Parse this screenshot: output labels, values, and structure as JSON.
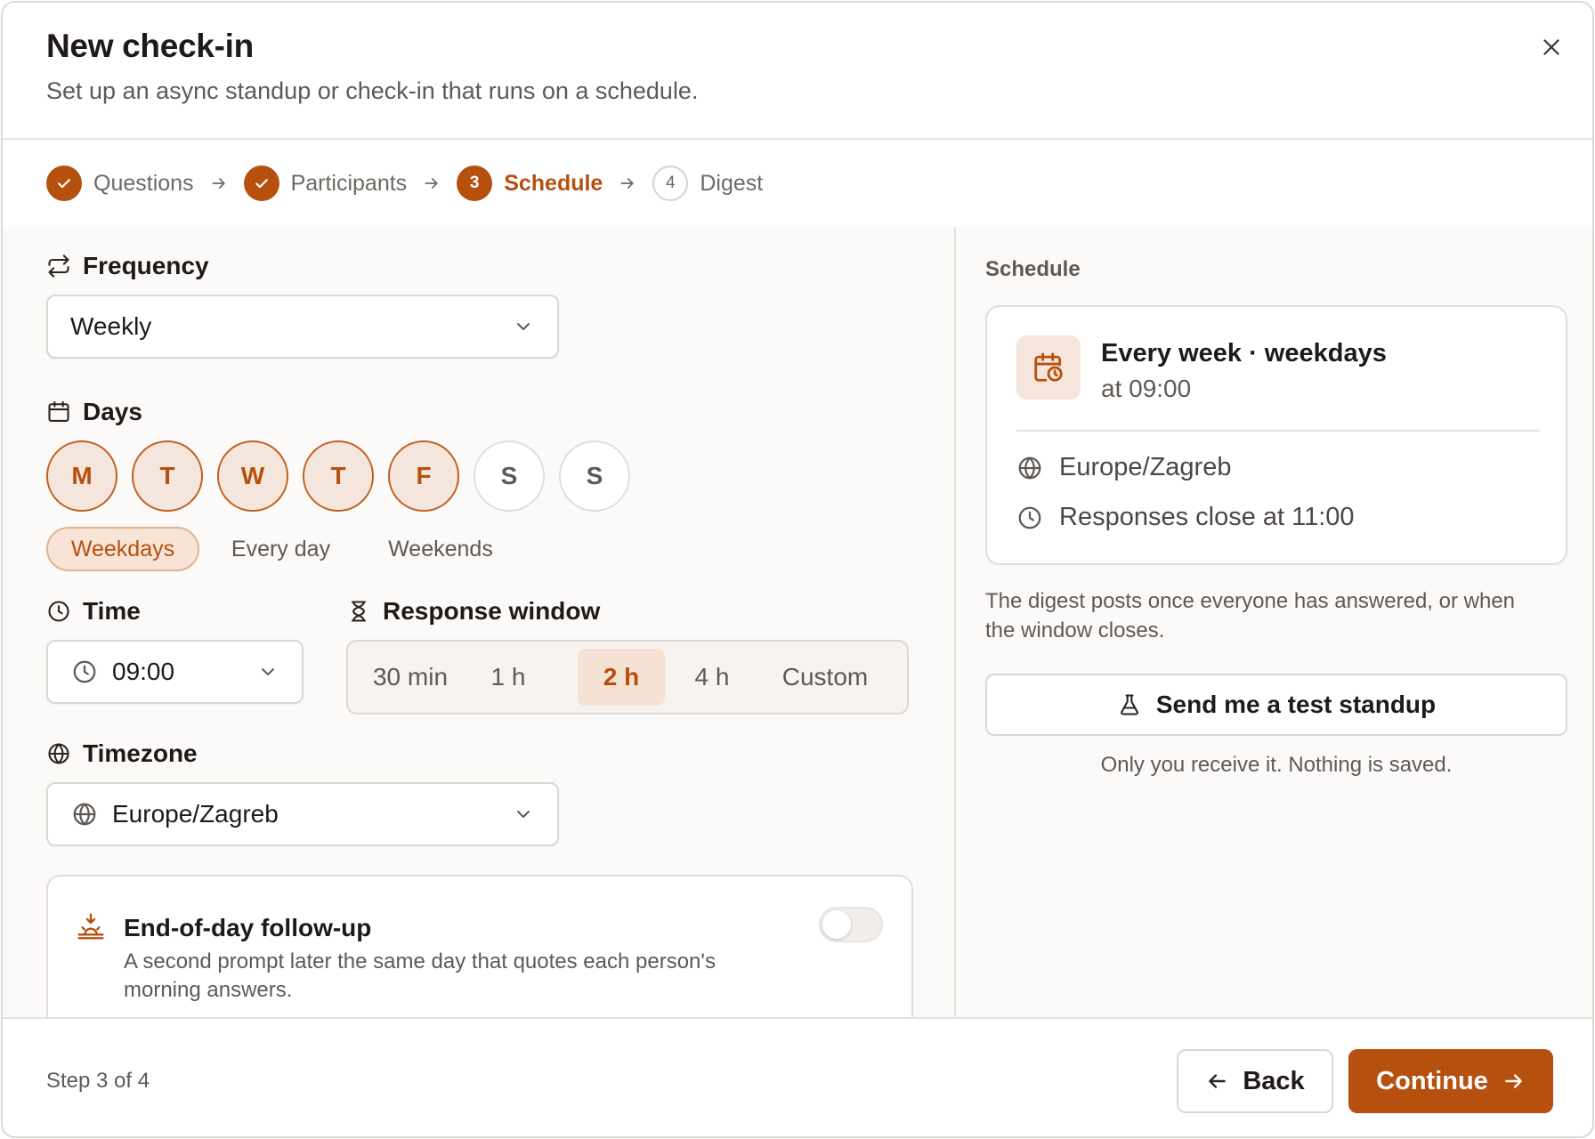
{
  "dialog": {
    "title": "New check-in",
    "subtitle": "Set up an async standup or check-in that runs on a schedule."
  },
  "stepper": {
    "steps": [
      {
        "label": "Questions",
        "state": "done",
        "marker": ""
      },
      {
        "label": "Participants",
        "state": "done",
        "marker": ""
      },
      {
        "label": "Schedule",
        "state": "current",
        "marker": "3"
      },
      {
        "label": "Digest",
        "state": "todo",
        "marker": "4"
      }
    ]
  },
  "form": {
    "frequency": {
      "label": "Frequency",
      "value": "Weekly"
    },
    "days": {
      "label": "Days",
      "items": [
        {
          "letter": "M",
          "selected": true
        },
        {
          "letter": "T",
          "selected": true
        },
        {
          "letter": "W",
          "selected": true
        },
        {
          "letter": "T",
          "selected": true
        },
        {
          "letter": "F",
          "selected": true
        },
        {
          "letter": "S",
          "selected": false
        },
        {
          "letter": "S",
          "selected": false
        }
      ],
      "presets": [
        {
          "label": "Weekdays",
          "active": true
        },
        {
          "label": "Every day",
          "active": false
        },
        {
          "label": "Weekends",
          "active": false
        }
      ]
    },
    "time": {
      "label": "Time",
      "value": "09:00"
    },
    "response_window": {
      "label": "Response window",
      "options": [
        {
          "label": "30 min",
          "active": false
        },
        {
          "label": "1 h",
          "active": false
        },
        {
          "label": "2 h",
          "active": true
        },
        {
          "label": "4 h",
          "active": false
        },
        {
          "label": "Custom",
          "active": false
        }
      ]
    },
    "timezone": {
      "label": "Timezone",
      "value": "Europe/Zagreb"
    },
    "followup": {
      "title": "End-of-day follow-up",
      "description_line1": "A second prompt later the same day that quotes each person's",
      "description_line2": "morning answers.",
      "enabled": false
    }
  },
  "summary": {
    "section_label": "Schedule",
    "headline": "Every week · weekdays",
    "time_line": "at 09:00",
    "timezone": "Europe/Zagreb",
    "close_line": "Responses close at 11:00",
    "note_line1": "The digest posts once everyone has answered, or when",
    "note_line2": "the window closes.",
    "test_button": "Send me a test standup",
    "test_caption": "Only you receive it. Nothing is saved."
  },
  "footer": {
    "step_text": "Step 3 of 4",
    "back_label": "Back",
    "continue_label": "Continue"
  },
  "colors": {
    "accent": "#b6500f",
    "accent_soft": "#f5e6dd",
    "border": "#dcd7d2",
    "background": "#fbfaf9"
  }
}
